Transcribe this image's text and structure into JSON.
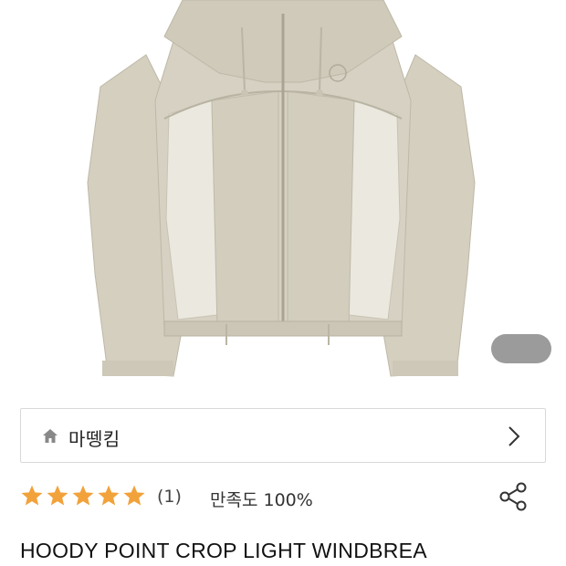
{
  "store": {
    "icon": "home-icon",
    "name": "마뗑킴",
    "chevron": "chevron-right-icon"
  },
  "rating": {
    "stars": 5,
    "star_color": "#f2a23b",
    "review_count": "(1)",
    "satisfaction": "만족도 100%"
  },
  "share": {
    "icon": "share-icon"
  },
  "product": {
    "title": "HOODY POINT CROP LIGHT WINDBREA",
    "image_colors": {
      "shell": "#d4cfbf",
      "panel": "#ebe8df",
      "trim": "#b8b3a2"
    }
  },
  "gallery": {
    "indicator_color": "#9b9b9b"
  }
}
